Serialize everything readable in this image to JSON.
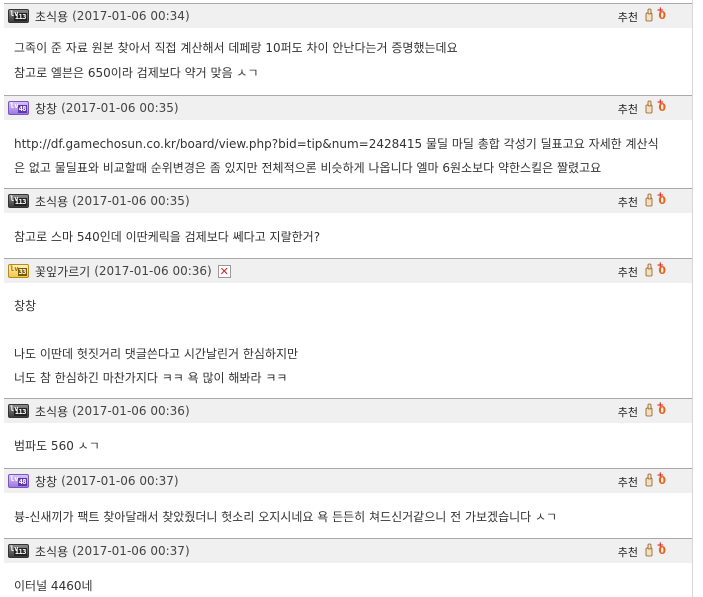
{
  "comments": [
    {
      "badge": "gray",
      "badge_num": "113",
      "nick": "초식용",
      "date": "(2017-01-06 00:34)",
      "reco_label": "추천",
      "reco_count": "0",
      "lines": [
        "그족이 준 자료 원본 찾아서 직접 계산해서 데페랑 10퍼도 차이 안난다는거 증명했는데요",
        "참고로 엘븐은 650이라 검제보다 약거 맞음 ㅅㄱ"
      ]
    },
    {
      "badge": "purple",
      "badge_num": "48",
      "nick": "창창",
      "date": "(2017-01-06 00:35)",
      "reco_label": "추천",
      "reco_count": "0",
      "lines": [
        "http://df.gamechosun.co.kr/board/view.php?bid=tip&num=2428415 물딜 마딜 총합 각성기 딜표고요 자세한 계산식",
        "은 없고 물딜표와 비교할때 순위변경은 좀 있지만 전체적으론 비슷하게 나옵니다 엘마 6원소보다 약한스킬은 짤렸고요"
      ]
    },
    {
      "badge": "gray",
      "badge_num": "113",
      "nick": "초식용",
      "date": "(2017-01-06 00:35)",
      "reco_label": "추천",
      "reco_count": "0",
      "lines": [
        "참고로 스마 540인데 이딴케릭을 검제보다 쎄다고 지랄한거?"
      ]
    },
    {
      "badge": "yellow",
      "badge_num": "33",
      "nick": "꽃잎가르기",
      "date": "(2017-01-06 00:36)",
      "delete_icon": "✕",
      "reco_label": "추천",
      "reco_count": "0",
      "lines": [
        "창창",
        "나도 이딴데 헛짓거리 댓글쓴다고 시간날린거 한심하지만",
        "너도 참 한심하긴 마찬가지다 ㅋㅋ 욕 많이 해봐라 ㅋㅋ"
      ]
    },
    {
      "badge": "gray",
      "badge_num": "113",
      "nick": "초식용",
      "date": "(2017-01-06 00:36)",
      "reco_label": "추천",
      "reco_count": "0",
      "lines": [
        "범파도 560 ㅅㄱ"
      ]
    },
    {
      "badge": "purple",
      "badge_num": "48",
      "nick": "창창",
      "date": "(2017-01-06 00:37)",
      "reco_label": "추천",
      "reco_count": "0",
      "lines": [
        "븅-신새끼가 팩트 찾아달래서 찾았줬더니 헛소리 오지시네요 욕 든든히 쳐드신거같으니 전 가보겠습니다 ㅅㄱ"
      ]
    },
    {
      "badge": "gray",
      "badge_num": "113",
      "nick": "초식용",
      "date": "(2017-01-06 00:37)",
      "reco_label": "추천",
      "reco_count": "0",
      "lines": [
        "이터널 4460네"
      ]
    }
  ],
  "icons": {
    "thumb": "thumbs-up-icon",
    "delete": "delete-icon",
    "level": "level-badge-icon"
  },
  "colors": {
    "header_bg": "#f0f0f0",
    "count": "#e8651a",
    "reco_mark": "#e02020"
  }
}
